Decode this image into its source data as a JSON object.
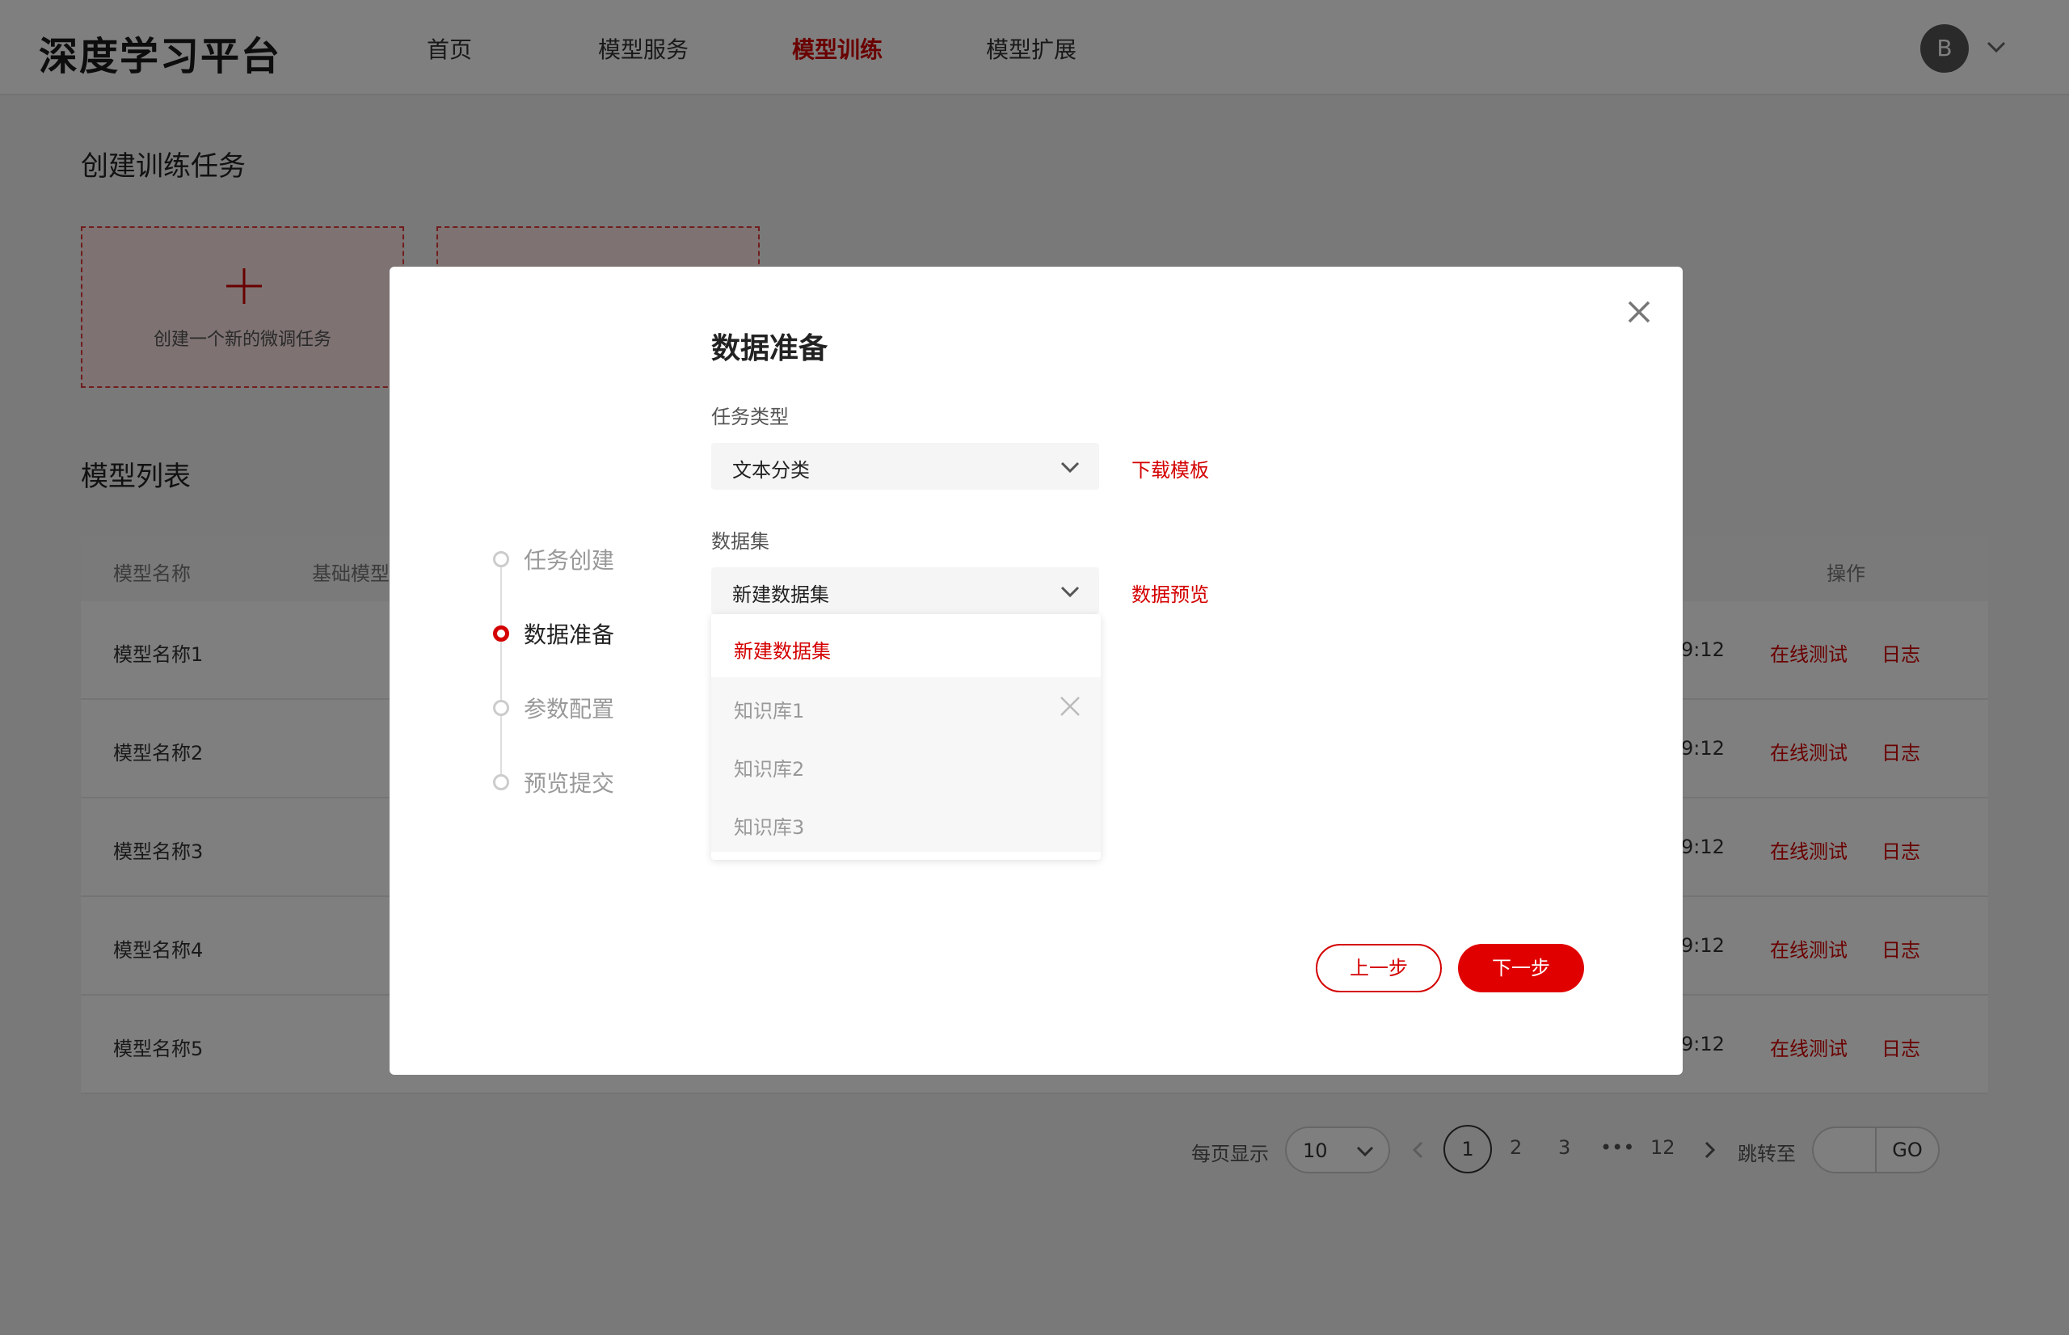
{
  "app": {
    "title": "深度学习平台"
  },
  "nav": {
    "items": [
      "首页",
      "模型服务",
      "模型训练",
      "模型扩展"
    ],
    "active_index": 2
  },
  "user": {
    "avatar_letter": "B"
  },
  "create_section": {
    "title": "创建训练任务",
    "new_card_label": "创建一个新的微调任务"
  },
  "model_list": {
    "title": "模型列表",
    "columns": [
      "模型名称",
      "基础模型",
      "操作"
    ],
    "rows": [
      {
        "name": "模型名称1",
        "time_fragment": "9:12",
        "test": "在线测试",
        "log": "日志"
      },
      {
        "name": "模型名称2",
        "time_fragment": "9:12",
        "test": "在线测试",
        "log": "日志"
      },
      {
        "name": "模型名称3",
        "time_fragment": "9:12",
        "test": "在线测试",
        "log": "日志"
      },
      {
        "name": "模型名称4",
        "time_fragment": "9:12",
        "test": "在线测试",
        "log": "日志"
      },
      {
        "name": "模型名称5",
        "time_fragment": "9:12",
        "test": "在线测试",
        "log": "日志"
      }
    ]
  },
  "pagination": {
    "per_page_label": "每页显示",
    "per_page_value": "10",
    "pages": [
      "1",
      "2",
      "3",
      "•••",
      "12"
    ],
    "current_page": "1",
    "jump_label": "跳转至",
    "go_label": "GO"
  },
  "modal": {
    "title": "数据准备",
    "steps": [
      "任务创建",
      "数据准备",
      "参数配置",
      "预览提交"
    ],
    "active_step": 1,
    "task_type": {
      "label": "任务类型",
      "value": "文本分类",
      "link": "下载模板"
    },
    "dataset": {
      "label": "数据集",
      "value": "新建数据集",
      "link": "数据预览",
      "options": [
        "新建数据集",
        "知识库1",
        "知识库2",
        "知识库3"
      ]
    },
    "prev_button": "上一步",
    "next_button": "下一步"
  },
  "colors": {
    "accent": "#d40000",
    "overlay": "rgba(0,0,0,0.5)"
  }
}
